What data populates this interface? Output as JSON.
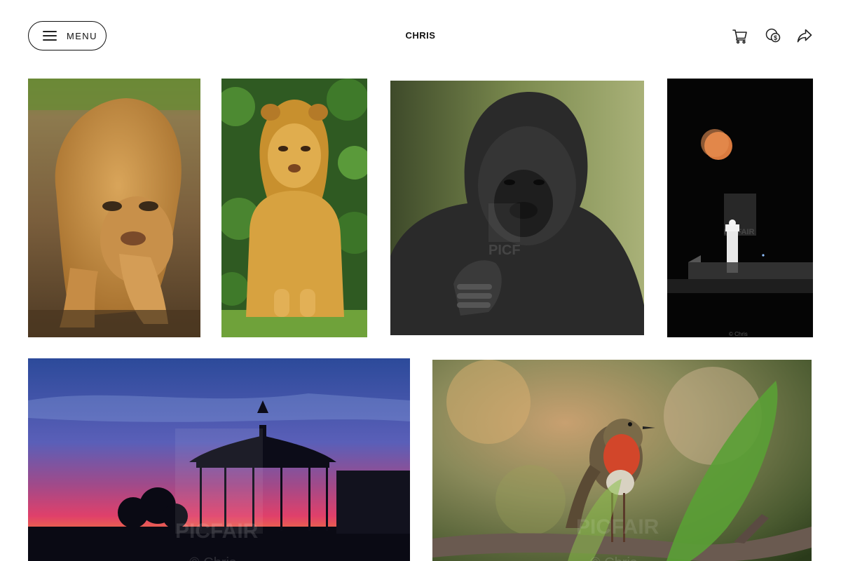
{
  "header": {
    "menu_label": "MENU",
    "site_title": "CHRIS",
    "icons": [
      "hamburger-icon",
      "cart-icon",
      "pricing-icon",
      "share-icon"
    ]
  },
  "gallery": {
    "photos": [
      {
        "subject": "lion-cub-walking"
      },
      {
        "subject": "lion-cub-sitting"
      },
      {
        "subject": "gorilla"
      },
      {
        "subject": "moon-over-lighthouse",
        "credit": "© Chris"
      },
      {
        "subject": "bandstand-sunset",
        "watermark": "PICFAIR",
        "credit": "© Chris"
      },
      {
        "subject": "robin-on-branch",
        "watermark": "PICFAIR",
        "credit": "© Chris"
      }
    ]
  },
  "colors": {
    "text": "#111111",
    "background": "#ffffff"
  }
}
